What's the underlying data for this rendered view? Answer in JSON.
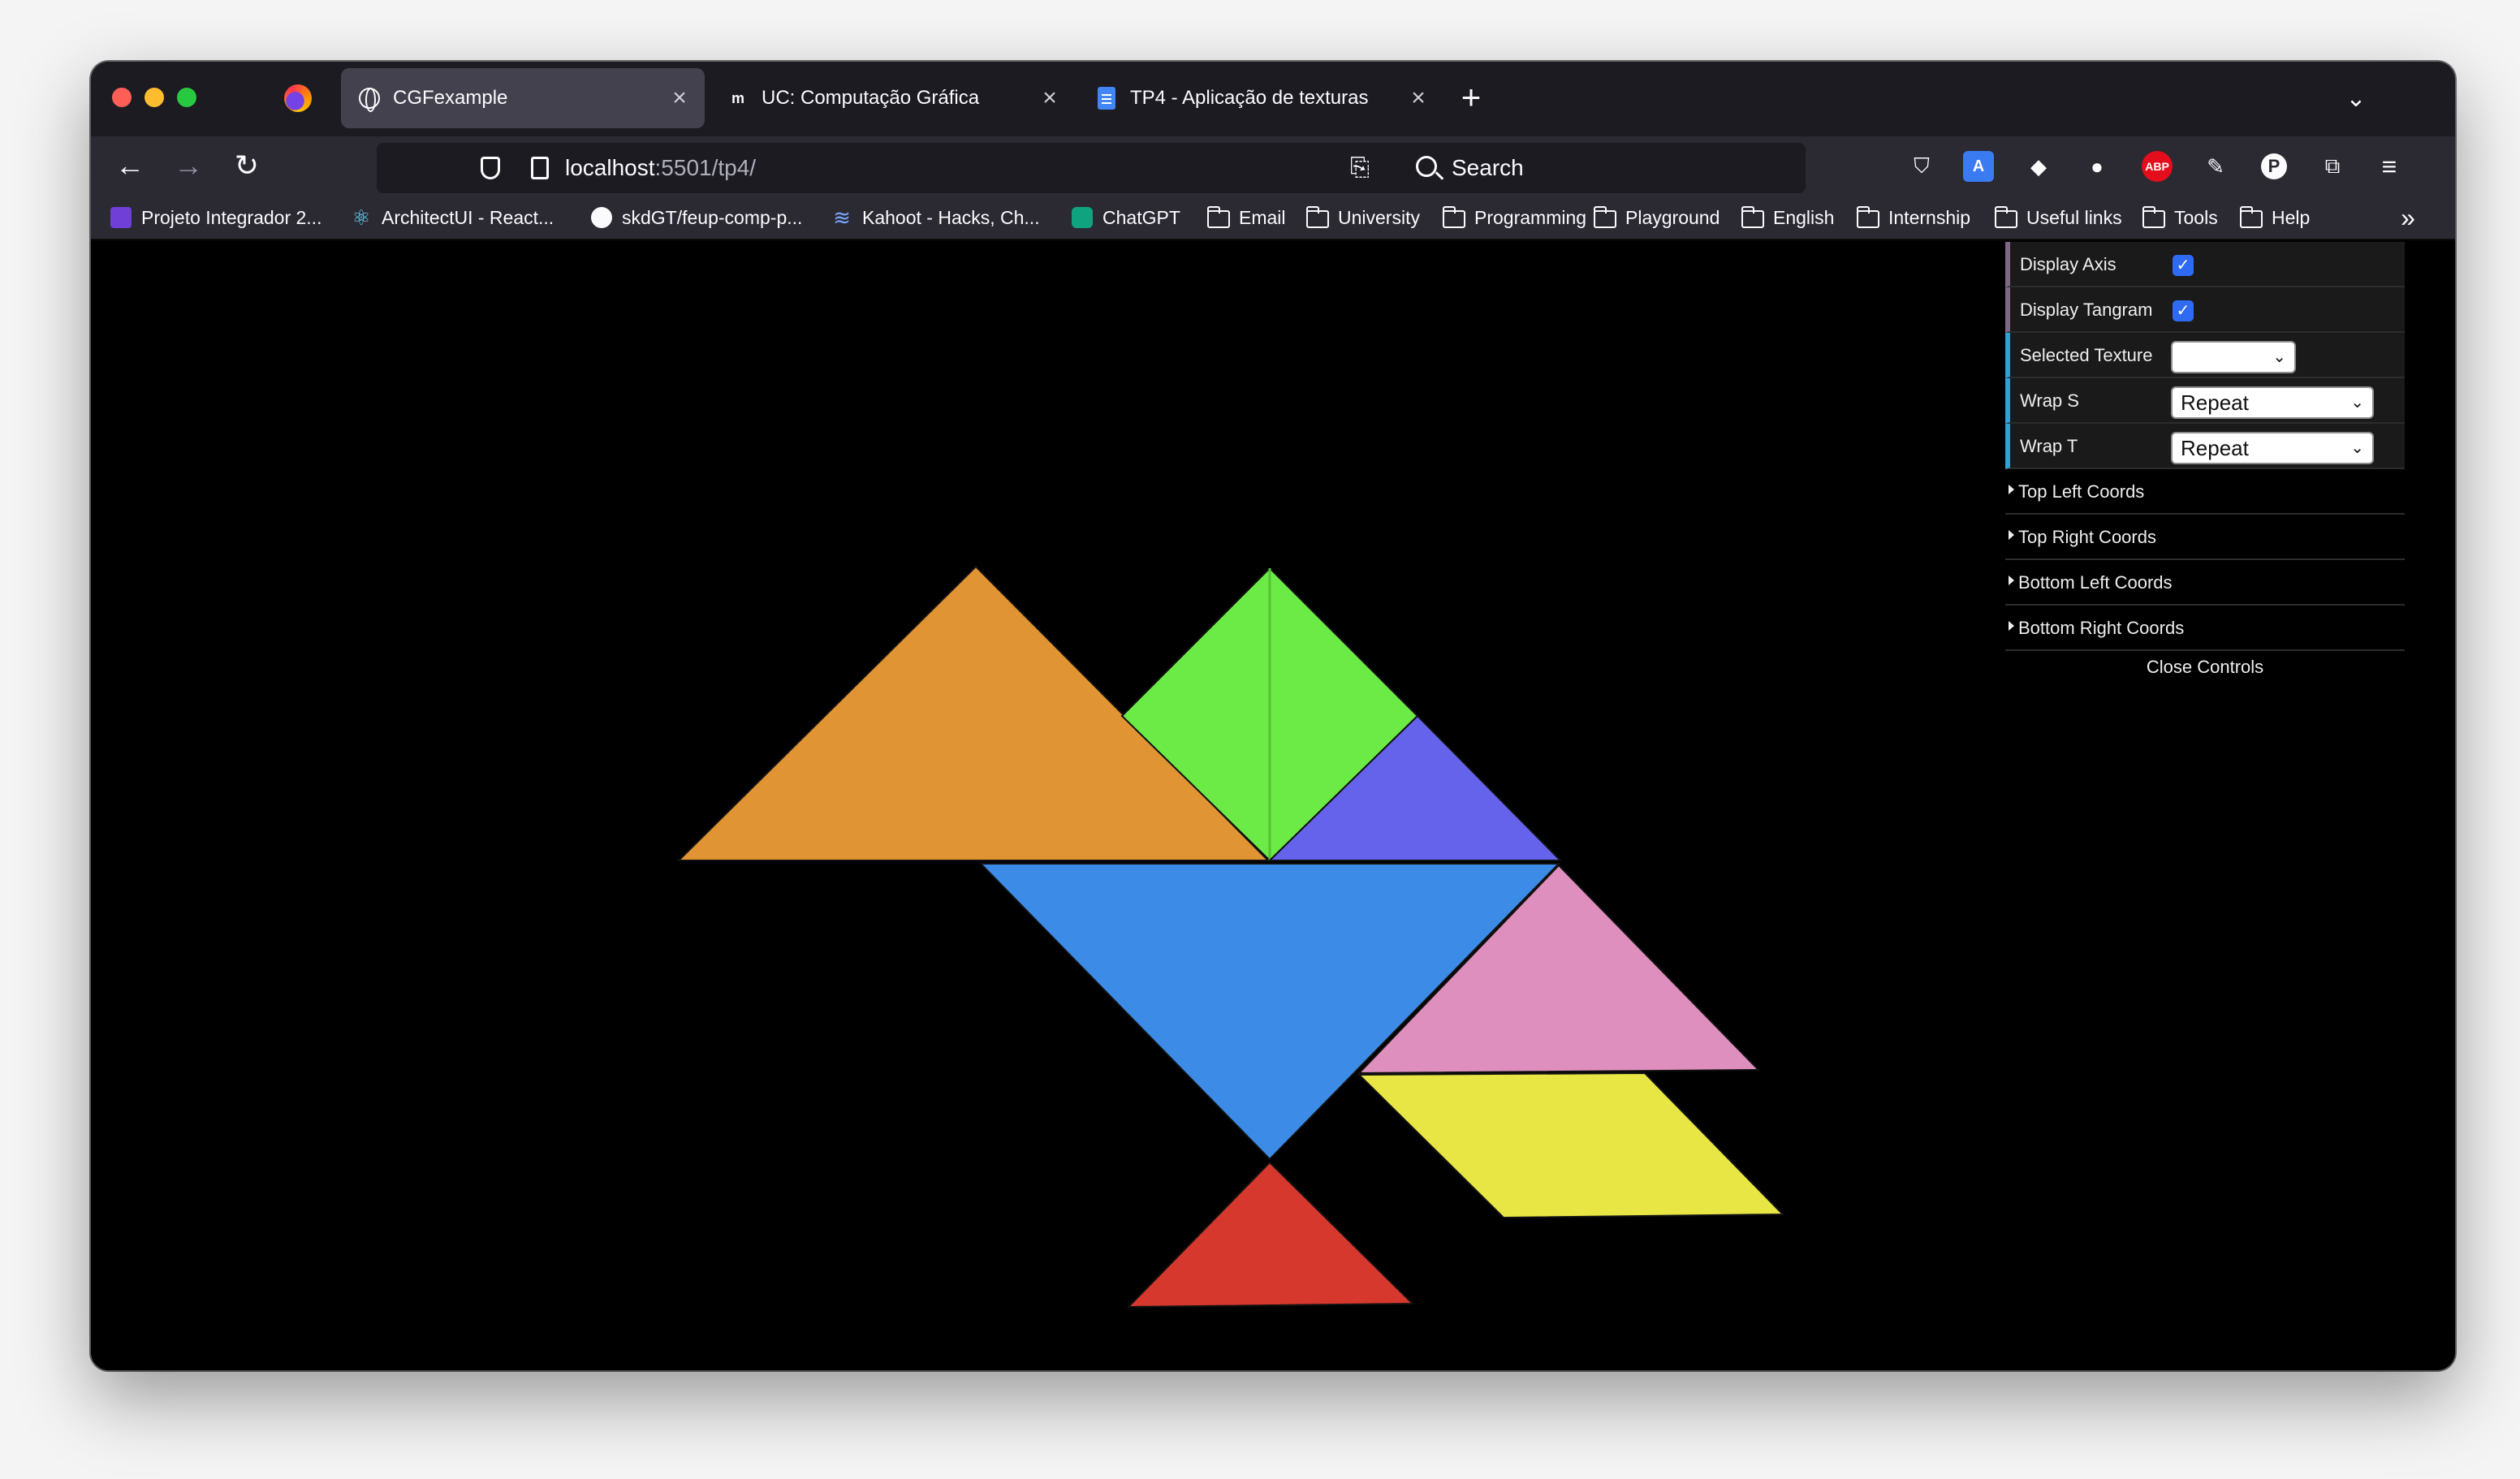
{
  "browser": {
    "tabs": [
      {
        "title": "CGFexample",
        "active": true
      },
      {
        "title": "UC: Computação Gráfica",
        "active": false
      },
      {
        "title": "TP4 - Aplicação de texturas",
        "active": false
      }
    ],
    "url_host": "localhost",
    "url_rest": ":5501/tp4/",
    "search_placeholder": "Search",
    "bookmarks": [
      {
        "label": "Projeto Integrador 2...",
        "icon": "purple-list-icon"
      },
      {
        "label": "ArchitectUI - React...",
        "icon": "react-icon"
      },
      {
        "label": "skdGT/feup-comp-p...",
        "icon": "github-icon"
      },
      {
        "label": "Kahoot - Hacks, Ch...",
        "icon": "stack-icon"
      },
      {
        "label": "ChatGPT",
        "icon": "chatgpt-icon"
      },
      {
        "label": "Email",
        "icon": "folder-icon"
      },
      {
        "label": "University",
        "icon": "folder-icon"
      },
      {
        "label": "Programming",
        "icon": "folder-icon"
      },
      {
        "label": "Playground",
        "icon": "folder-icon"
      },
      {
        "label": "English",
        "icon": "folder-icon"
      },
      {
        "label": "Internship",
        "icon": "folder-icon"
      },
      {
        "label": "Useful links",
        "icon": "folder-icon"
      },
      {
        "label": "Tools",
        "icon": "folder-icon"
      },
      {
        "label": "Help",
        "icon": "folder-icon"
      }
    ],
    "toolbar_icons": [
      "pocket-icon",
      "translate-icon",
      "extension-arrow-icon",
      "extension-ghost-icon",
      "adblock-icon",
      "pen-icon",
      "p-profile-icon",
      "extensions-icon",
      "menu-icon"
    ],
    "abp_text": "ABP",
    "profile_letter": "P"
  },
  "gui": {
    "display_axis": {
      "label": "Display Axis",
      "checked": true
    },
    "display_tangram": {
      "label": "Display Tangram",
      "checked": true
    },
    "selected_texture": {
      "label": "Selected Texture",
      "value": ""
    },
    "wrap_s": {
      "label": "Wrap S",
      "value": "Repeat"
    },
    "wrap_t": {
      "label": "Wrap T",
      "value": "Repeat"
    },
    "folders": [
      "Top Left Coords",
      "Top Right Coords",
      "Bottom Left Coords",
      "Bottom Right Coords"
    ],
    "close_label": "Close Controls"
  },
  "scene": {
    "pieces": [
      {
        "name": "orange-triangle",
        "color": "#e09433"
      },
      {
        "name": "green-diamond",
        "color": "#6ceb47"
      },
      {
        "name": "purple-triangle",
        "color": "#6563ec"
      },
      {
        "name": "blue-triangle",
        "color": "#3c8be6"
      },
      {
        "name": "pink-triangle",
        "color": "#de8fbd"
      },
      {
        "name": "yellow-parallelogram",
        "color": "#e8e645"
      },
      {
        "name": "red-triangle",
        "color": "#d6382d"
      }
    ]
  }
}
